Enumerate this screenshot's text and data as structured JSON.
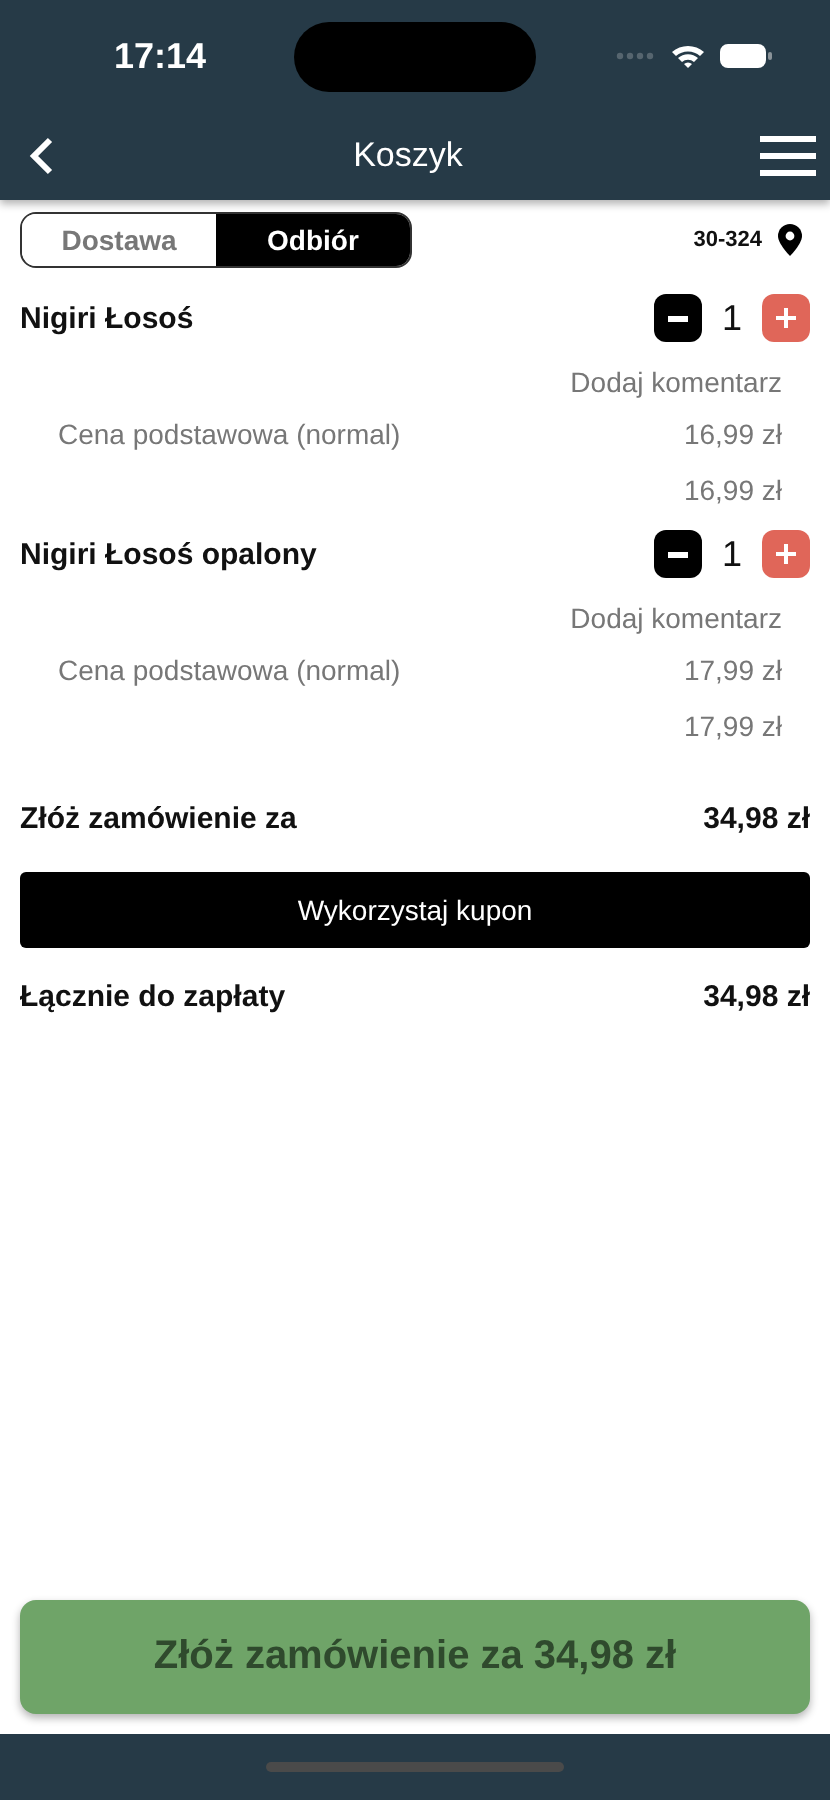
{
  "status_bar": {
    "time": "17:14"
  },
  "nav": {
    "title": "Koszyk"
  },
  "tabs": [
    {
      "label": "Dostawa",
      "selected": false
    },
    {
      "label": "Odbiór",
      "selected": true
    }
  ],
  "postal_code": "30-324",
  "items": [
    {
      "name": "Nigiri Łosoś",
      "quantity": "1",
      "comment_link": "Dodaj komentarz",
      "price_label": "Cena podstawowa (normal)",
      "price": "16,99 zł",
      "total": "16,99 zł"
    },
    {
      "name": "Nigiri Łosoś opalony",
      "quantity": "1",
      "comment_link": "Dodaj komentarz",
      "price_label": "Cena podstawowa (normal)",
      "price": "17,99 zł",
      "total": "17,99 zł"
    }
  ],
  "order_total": {
    "label": "Złóż zamówienie za",
    "value": "34,98 zł"
  },
  "coupon_button": "Wykorzystaj kupon",
  "payment_total": {
    "label": "Łącznie do zapłaty",
    "value": "34,98 zł"
  },
  "submit_button": "Złóż zamówienie za 34,98 zł"
}
